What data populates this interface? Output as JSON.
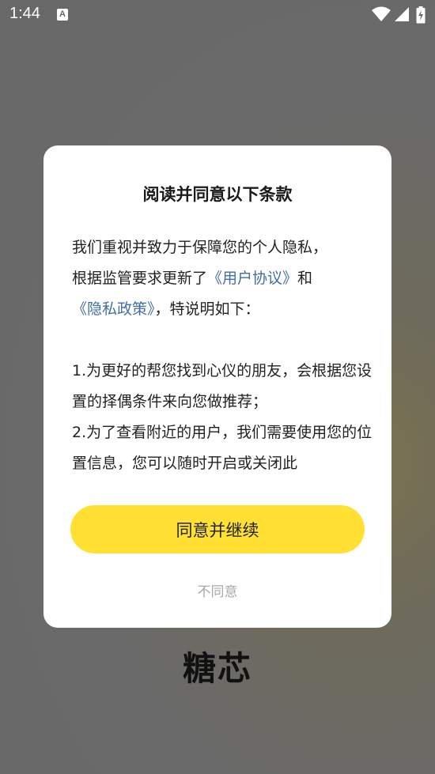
{
  "status_bar": {
    "time": "1:44",
    "notification_icon_letter": "A",
    "icons": [
      "wifi-icon",
      "cellular-signal-icon",
      "battery-charging-icon"
    ]
  },
  "dialog": {
    "title": "阅读并同意以下条款",
    "intro": {
      "line1": "我们重视并致力于保障您的个人隐私，",
      "line2_prefix": "根据监管要求更新了",
      "user_agreement_link": "《用户协议》",
      "line2_and": "和",
      "privacy_policy_link": "《隐私政策》",
      "line3_suffix": "，特说明如下："
    },
    "clauses": [
      "1.为更好的帮您找到心仪的朋友，会根据您设置的择偶条件来向您做推荐；",
      "2.为了查看附近的用户，我们需要使用您的位置信息，您可以随时开启或关闭此"
    ],
    "agree_button": "同意并继续",
    "disagree_button": "不同意"
  },
  "app": {
    "brand_name": "糖芯"
  },
  "colors": {
    "accent": "#ffe033",
    "link": "#3f6ea8",
    "overlay": "#6a6a6a"
  }
}
